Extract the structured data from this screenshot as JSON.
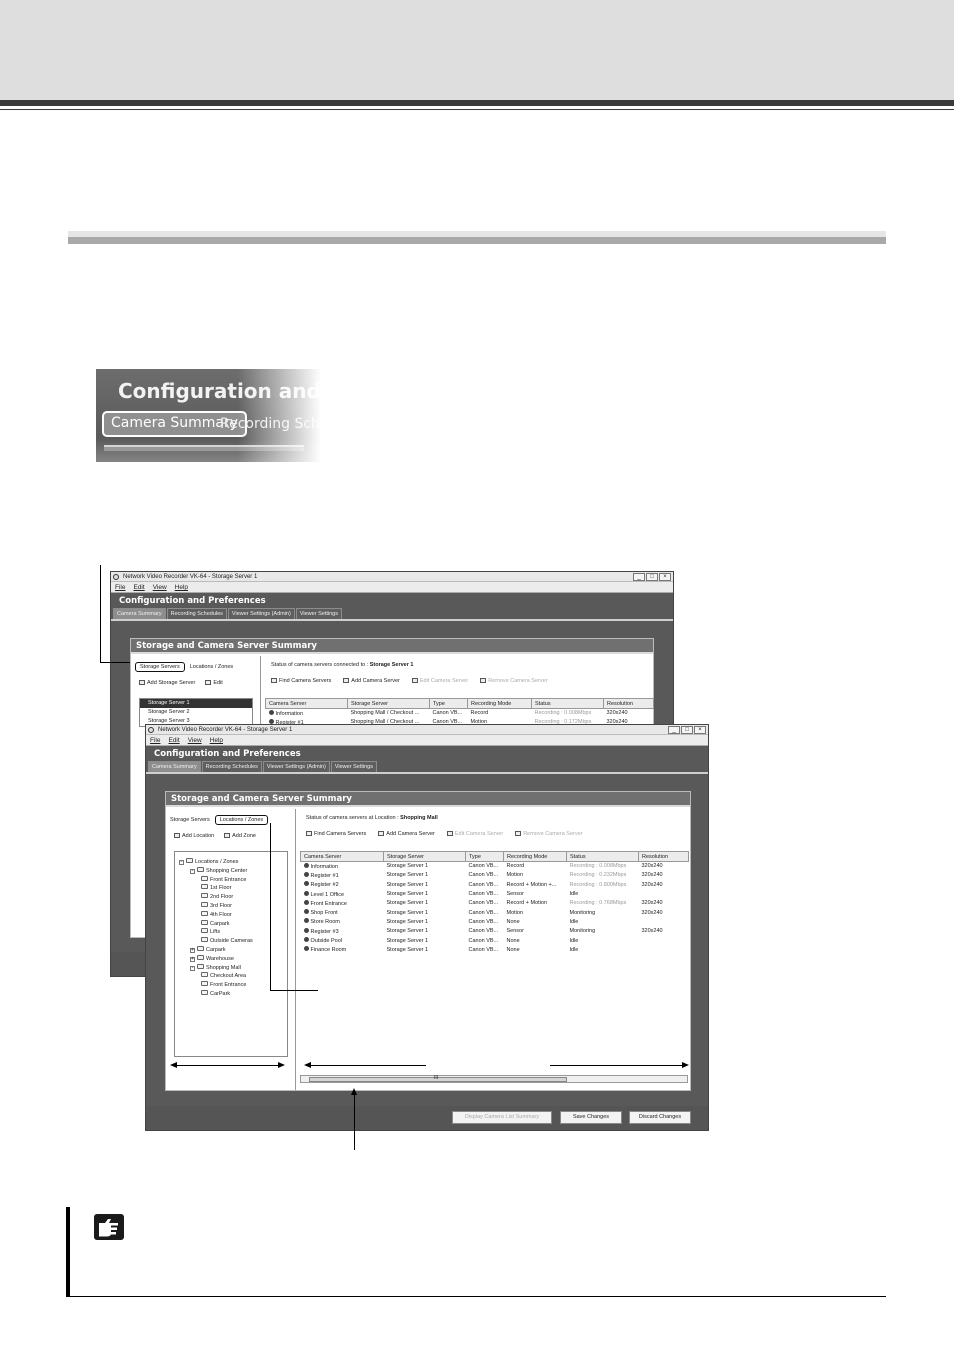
{
  "zoom_inset": {
    "title": "Configuration and Pr",
    "tab_active": "Camera Summary",
    "tab_next": "Recording Sched"
  },
  "win1": {
    "title": "Network Video Recorder VK-64 - Storage Server 1",
    "menus": [
      "File",
      "Edit",
      "View",
      "Help"
    ],
    "app_title": "Configuration and Preferences",
    "tabs": [
      "Camera Summary",
      "Recording Schedules",
      "Viewer Settings (Admin)",
      "Viewer Settings"
    ],
    "frame_title": "Storage and Camera Server Summary",
    "left_tabs": [
      "Storage Servers",
      "Locations / Zones"
    ],
    "left_actions": [
      "Add Storage Server",
      "Edit"
    ],
    "servers": [
      "Storage Server 1",
      "Storage Server 2",
      "Storage Server 3"
    ],
    "status_prefix": "Status of camera servers connected to :",
    "status_target": "Storage Server 1",
    "toolbar": [
      "Find Camera Servers",
      "Add Camera Server",
      "Edit Camera Server",
      "Remove Camera Server"
    ],
    "columns": [
      "Camera Server",
      "Storage Server",
      "Type",
      "Recording Mode",
      "Status",
      "Resolution"
    ],
    "rows": [
      [
        "Information",
        "Shopping Mall / Checkout ...",
        "Canon VB...",
        "Record",
        "Recording : 0.008Mbps",
        "320x240"
      ],
      [
        "Register #1",
        "Shopping Mall / Checkout ...",
        "Canon VB...",
        "Motion",
        "Recording : 0.172Mbps",
        "320x240"
      ]
    ]
  },
  "win2": {
    "title": "Network Video Recorder VK-64 - Storage Server 1",
    "menus": [
      "File",
      "Edit",
      "View",
      "Help"
    ],
    "app_title": "Configuration and Preferences",
    "tabs": [
      "Camera Summary",
      "Recording Schedules",
      "Viewer Settings (Admin)",
      "Viewer Settings"
    ],
    "frame_title": "Storage and Camera Server Summary",
    "left_tabs": [
      "Storage Servers",
      "Locations / Zones"
    ],
    "left_actions": [
      "Add Location",
      "Add Zone"
    ],
    "tree": [
      {
        "label": "Locations / Zones",
        "level": 0,
        "exp": "-"
      },
      {
        "label": "Shopping Center",
        "level": 1,
        "exp": "-"
      },
      {
        "label": "Front Entrance",
        "level": 2,
        "exp": ""
      },
      {
        "label": "1st Floor",
        "level": 2,
        "exp": ""
      },
      {
        "label": "2nd Floor",
        "level": 2,
        "exp": ""
      },
      {
        "label": "3rd Floor",
        "level": 2,
        "exp": ""
      },
      {
        "label": "4th Floor",
        "level": 2,
        "exp": ""
      },
      {
        "label": "Carpark",
        "level": 2,
        "exp": ""
      },
      {
        "label": "Lifts",
        "level": 2,
        "exp": ""
      },
      {
        "label": "Outside Cameras",
        "level": 2,
        "exp": ""
      },
      {
        "label": "Carpark",
        "level": 1,
        "exp": "+"
      },
      {
        "label": "Warehouse",
        "level": 1,
        "exp": "+"
      },
      {
        "label": "Shopping Mall",
        "level": 1,
        "exp": "-"
      },
      {
        "label": "Checkout Area",
        "level": 2,
        "exp": ""
      },
      {
        "label": "Front Entrance",
        "level": 2,
        "exp": ""
      },
      {
        "label": "CarPark",
        "level": 2,
        "exp": ""
      }
    ],
    "status_prefix": "Status of camera servers at Location :",
    "status_target": "Shopping Mall",
    "toolbar": [
      "Find Camera Servers",
      "Add Camera Server",
      "Edit Camera Server",
      "Remove Camera Server"
    ],
    "columns": [
      "Camera Server",
      "Storage Server",
      "Type",
      "Recording Mode",
      "Status",
      "Resolution"
    ],
    "rows": [
      [
        "Information",
        "Storage Server 1",
        "Canon VB...",
        "Record",
        "Recording : 0.008Mbps",
        "320x240"
      ],
      [
        "Register #1",
        "Storage Server 1",
        "Canon VB...",
        "Motion",
        "Recording : 0.232Mbps",
        "320x240"
      ],
      [
        "Register #2",
        "Storage Server 1",
        "Canon VB...",
        "Record + Motion +...",
        "Recording : 0.800Mbps",
        "320x240"
      ],
      [
        "Level 1 Office",
        "Storage Server 1",
        "Canon VB...",
        "Sensor",
        "Idle",
        ""
      ],
      [
        "Front Entrance",
        "Storage Server 1",
        "Canon VB...",
        "Record + Motion",
        "Recording : 0.768Mbps",
        "320x240"
      ],
      [
        "Shop Front",
        "Storage Server 1",
        "Canon VB...",
        "Motion",
        "Monitoring",
        "320x240"
      ],
      [
        "Store Room",
        "Storage Server 1",
        "Canon VB...",
        "None",
        "Idle",
        ""
      ],
      [
        "Register #3",
        "Storage Server 1",
        "Canon VB...",
        "Sensor",
        "Monitoring",
        "320x240"
      ],
      [
        "Outside Pool",
        "Storage Server 1",
        "Canon VB...",
        "None",
        "Idle",
        ""
      ],
      [
        "Finance Room",
        "Storage Server 1",
        "Canon VB...",
        "None",
        "Idle",
        ""
      ]
    ],
    "scroll_thumb": "III",
    "buttons": [
      "Display Camera List Summary",
      "Save Changes",
      "Discard Changes"
    ]
  }
}
